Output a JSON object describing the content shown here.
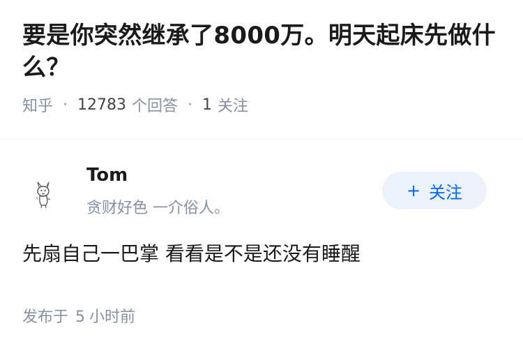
{
  "question": {
    "title": "要是你突然继承了8000万。明天起床先做什么？",
    "source": "知乎",
    "answer_count": "12783",
    "answer_label": "个回答",
    "follower_count": "1",
    "follower_label": "关注"
  },
  "answer": {
    "author": {
      "name": "Tom",
      "bio": "贪财好色 一介俗人。",
      "avatar_icon": "cartoon-character-icon"
    },
    "follow_button": {
      "icon": "plus-icon",
      "plus": "+",
      "label": "关注"
    },
    "content": "先扇自己一巴掌 看看是不是还没有睡醒",
    "time": {
      "prefix": "发布于",
      "value": "5",
      "unit": "小时前"
    }
  },
  "colors": {
    "meta_gray": "#8590a6",
    "follow_bg": "#ebf2fb",
    "follow_text": "#0066ff",
    "divider": "#f0f2f7"
  }
}
